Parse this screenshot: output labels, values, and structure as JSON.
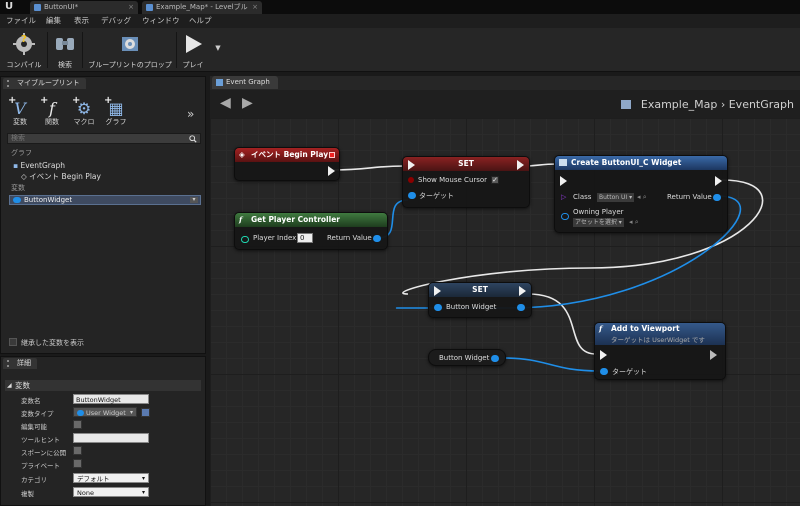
{
  "titlebar": {
    "logo": "U",
    "tabs": [
      "ButtonUI*",
      "Example_Map* - Levelブル"
    ]
  },
  "menubar": [
    "ファイル",
    "編集",
    "表示",
    "デバッグ",
    "ウィンドウ",
    "ヘルプ"
  ],
  "toolbar": {
    "buttons": [
      {
        "label": "コンパイル",
        "icon": "compile-icon"
      },
      {
        "label": "検索",
        "icon": "binoculars-icon"
      },
      {
        "label": "ブループリントのプロップ",
        "icon": "blueprint-props-icon"
      },
      {
        "label": "プレイ",
        "icon": "play-icon"
      }
    ]
  },
  "my_blueprint": {
    "tab": "マイブループリント",
    "add": [
      {
        "label": "変数",
        "glyph": "V"
      },
      {
        "label": "関数",
        "glyph": "f"
      },
      {
        "label": "マクロ",
        "glyph": "⚙"
      },
      {
        "label": "グラフ",
        "glyph": "▦"
      }
    ],
    "search_placeholder": "検索",
    "cat_graphs": "グラフ",
    "event_graph": "EventGraph",
    "event_begin": "イベント Begin Play",
    "cat_variables": "変数",
    "variable": "ButtonWidget",
    "show_inherited": "継承した変数を表示"
  },
  "details": {
    "tab": "詳細",
    "section": "変数",
    "rows": [
      {
        "key": "変数名",
        "value": "ButtonWidget"
      },
      {
        "key": "変数タイプ",
        "value": "User Widget"
      },
      {
        "key": "編集可能",
        "value": ""
      },
      {
        "key": "ツールヒント",
        "value": ""
      },
      {
        "key": "スポーンに公開",
        "value": ""
      },
      {
        "key": "プライベート",
        "value": ""
      },
      {
        "key": "カテゴリ",
        "value": "デフォルト"
      },
      {
        "key": "複製",
        "value": "None"
      }
    ]
  },
  "graph": {
    "tab": "Event Graph",
    "breadcrumb_map": "Example_Map",
    "breadcrumb_sep": "›",
    "breadcrumb_graph": "EventGraph",
    "nodes": {
      "begin_play": {
        "title": "イベント Begin Play"
      },
      "set1": {
        "title": "SET",
        "show_mouse": "Show Mouse Cursor",
        "target": "ターゲット"
      },
      "create_widget": {
        "title": "Create ButtonUI_C Widget",
        "class": "Class",
        "class_value": "Button UI",
        "owning": "Owning Player",
        "owning_value": "アセットを選択",
        "return": "Return Value"
      },
      "get_pc": {
        "title": "Get Player Controller",
        "player_index": "Player Index",
        "player_index_value": "0",
        "return": "Return Value"
      },
      "set2": {
        "title": "SET",
        "pin": "Button Widget"
      },
      "add_viewport": {
        "title": "Add to Viewport",
        "subtitle": "ターゲットは UserWidget です",
        "target": "ターゲット"
      },
      "get_var": {
        "title": "Button Widget"
      }
    }
  },
  "colors": {
    "event_red": "#8c1a1a",
    "set_red": "#7a1e1e",
    "pure_green": "#3b6e3b",
    "function_blue": "#2c4f7c",
    "object_pin": "#1f8ee8"
  }
}
